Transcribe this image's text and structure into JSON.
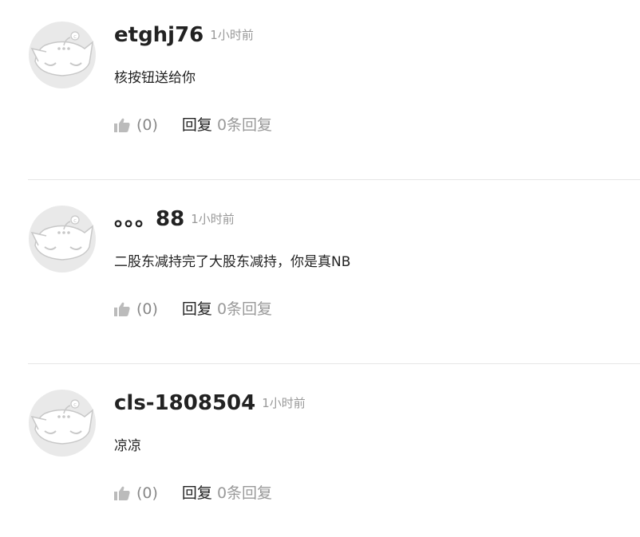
{
  "comments": [
    {
      "username": "etghj76",
      "time": "1小时前",
      "content": "核按钮送给你",
      "likes": "(0)",
      "reply_label": "回复",
      "reply_count": "0条回复"
    },
    {
      "username": "。。。88",
      "time": "1小时前",
      "content": "二股东减持完了大股东减持，你是真NB",
      "likes": "(0)",
      "reply_label": "回复",
      "reply_count": "0条回复"
    },
    {
      "username": "cls-1808504",
      "time": "1小时前",
      "content": "凉凉",
      "likes": "(0)",
      "reply_label": "回复",
      "reply_count": "0条回复"
    }
  ],
  "icons": {
    "avatar": "default-avatar-cat-icon",
    "like": "thumbs-up-icon"
  },
  "colors": {
    "username": "#222222",
    "meta": "#999999",
    "icon": "#bbbbbb",
    "divider": "#e6e6e6",
    "avatar_bg": "#e9e9e9"
  }
}
